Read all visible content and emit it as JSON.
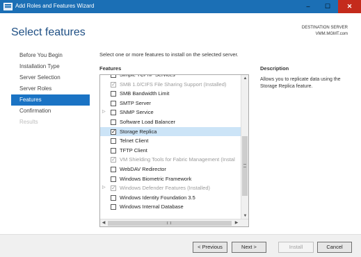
{
  "window": {
    "title": "Add Roles and Features Wizard",
    "icon": "server-manager-icon",
    "controls": {
      "minimize": "‒",
      "maximize": "☐",
      "close": "✕"
    }
  },
  "page_title": "Select features",
  "destination": {
    "label": "DESTINATION SERVER",
    "server": "VMM.MGMT.com"
  },
  "nav": {
    "items": [
      {
        "label": "Before You Begin",
        "state": "normal"
      },
      {
        "label": "Installation Type",
        "state": "normal"
      },
      {
        "label": "Server Selection",
        "state": "normal"
      },
      {
        "label": "Server Roles",
        "state": "normal"
      },
      {
        "label": "Features",
        "state": "active"
      },
      {
        "label": "Confirmation",
        "state": "normal"
      },
      {
        "label": "Results",
        "state": "disabled"
      }
    ]
  },
  "instruction": "Select one or more features to install on the selected server.",
  "features": {
    "heading": "Features",
    "items": [
      {
        "label": "Simple TCP/IP Services",
        "checked": false,
        "dim": false,
        "expander": false,
        "selected": false
      },
      {
        "label": "SMB 1.0/CIFS File Sharing Support (Installed)",
        "checked": true,
        "dim": true,
        "expander": false,
        "selected": false
      },
      {
        "label": "SMB Bandwidth Limit",
        "checked": false,
        "dim": false,
        "expander": false,
        "selected": false
      },
      {
        "label": "SMTP Server",
        "checked": false,
        "dim": false,
        "expander": false,
        "selected": false
      },
      {
        "label": "SNMP Service",
        "checked": false,
        "dim": false,
        "expander": true,
        "selected": false
      },
      {
        "label": "Software Load Balancer",
        "checked": false,
        "dim": false,
        "expander": false,
        "selected": false
      },
      {
        "label": "Storage Replica",
        "checked": true,
        "dim": false,
        "expander": false,
        "selected": true
      },
      {
        "label": "Telnet Client",
        "checked": false,
        "dim": false,
        "expander": false,
        "selected": false
      },
      {
        "label": "TFTP Client",
        "checked": false,
        "dim": false,
        "expander": false,
        "selected": false
      },
      {
        "label": "VM Shielding Tools for Fabric Management (Instal",
        "checked": true,
        "dim": true,
        "expander": false,
        "selected": false
      },
      {
        "label": "WebDAV Redirector",
        "checked": false,
        "dim": false,
        "expander": false,
        "selected": false
      },
      {
        "label": "Windows Biometric Framework",
        "checked": false,
        "dim": false,
        "expander": false,
        "selected": false
      },
      {
        "label": "Windows Defender Features (Installed)",
        "checked": true,
        "dim": true,
        "expander": true,
        "selected": false
      },
      {
        "label": "Windows Identity Foundation 3.5",
        "checked": false,
        "dim": false,
        "expander": false,
        "selected": false
      },
      {
        "label": "Windows Internal Database",
        "checked": false,
        "dim": false,
        "expander": false,
        "selected": false
      }
    ]
  },
  "description": {
    "heading": "Description",
    "text": "Allows you to replicate data using the Storage Replica feature."
  },
  "buttons": {
    "previous": "< Previous",
    "next": "Next >",
    "install": "Install",
    "cancel": "Cancel"
  },
  "colors": {
    "titlebar": "#1b6fb5",
    "nav_active": "#1a73c4",
    "selected_row": "#cce4f7",
    "page_title": "#1e4f84"
  }
}
